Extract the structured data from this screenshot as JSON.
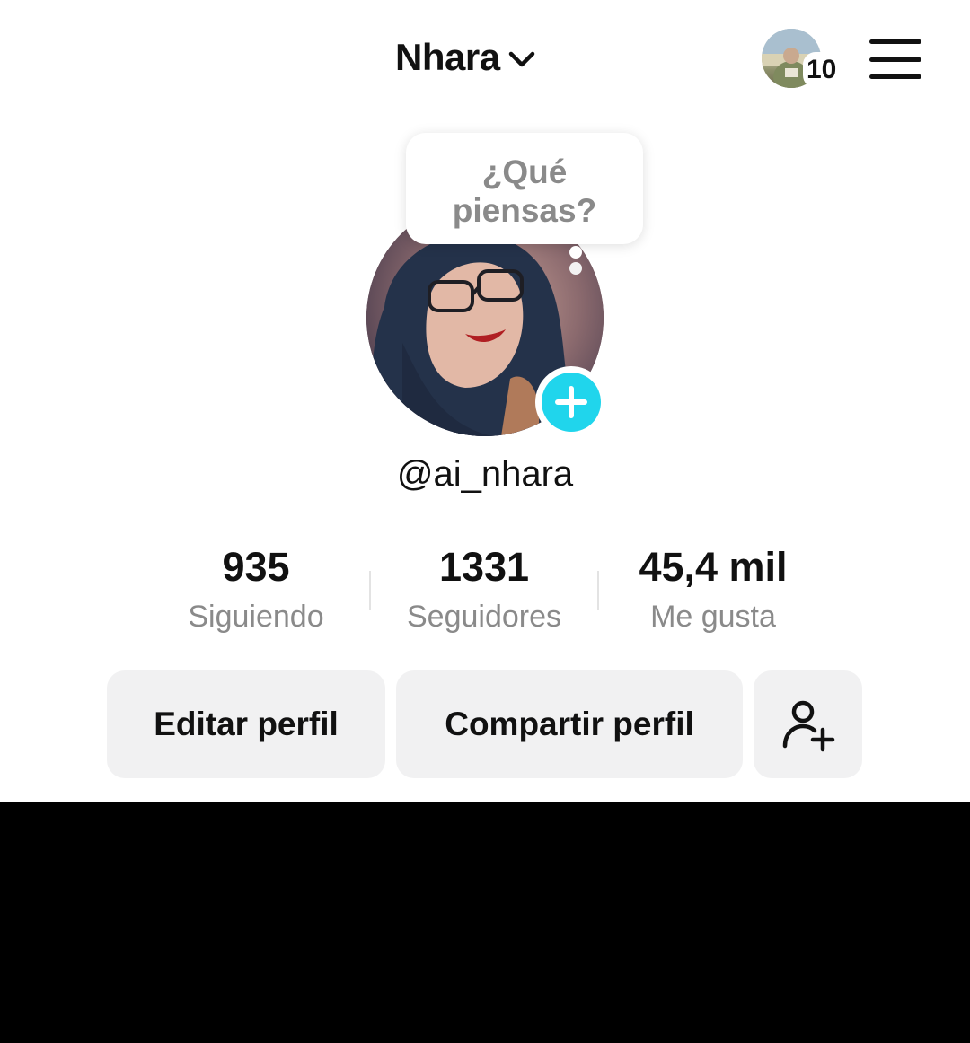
{
  "header": {
    "account_name": "Nhara",
    "friends_count": "10"
  },
  "thought_bubble": {
    "text": "¿Qué\npiensas?"
  },
  "profile": {
    "username": "@ai_nhara"
  },
  "stats": [
    {
      "value": "935",
      "label": "Siguiendo"
    },
    {
      "value": "1331",
      "label": "Seguidores"
    },
    {
      "value": "45,4 mil",
      "label": "Me gusta"
    }
  ],
  "actions": {
    "edit_label": "Editar perfil",
    "share_label": "Compartir perfil",
    "add_friend_icon": "person-plus-icon"
  },
  "colors": {
    "accent_cyan": "#20d5ec",
    "button_bg": "#f1f1f2",
    "secondary_text": "#8a8a8a"
  }
}
